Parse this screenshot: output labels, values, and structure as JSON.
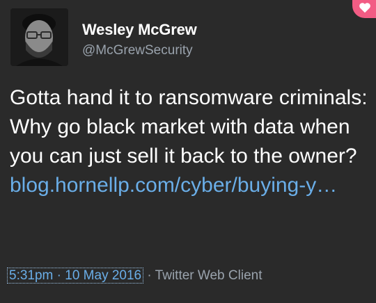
{
  "user": {
    "name": "Wesley McGrew",
    "handle": "@McGrewSecurity"
  },
  "tweet": {
    "text": "Gotta hand it to ransomware criminals: Why go black market with data when you can just sell it back to the owner?",
    "link_text": "blog.hornellp.com/cyber/buying-y…"
  },
  "meta": {
    "timestamp": "5:31pm · 10 May 2016",
    "separator": "·",
    "client": "Twitter Web Client"
  },
  "colors": {
    "background": "#2a2a2a",
    "link": "#6aaee8",
    "secondary_text": "#9aa3ad",
    "heart_badge": "#f25c84"
  },
  "icons": {
    "corner_badge": "heart-icon"
  }
}
